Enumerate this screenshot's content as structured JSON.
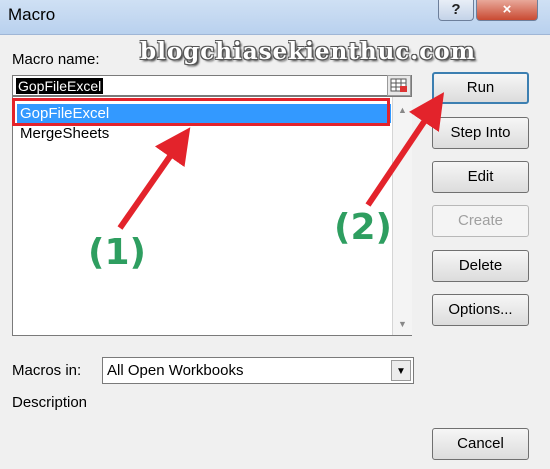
{
  "window": {
    "title": "Macro",
    "help_label": "?",
    "close_label": "×"
  },
  "watermark": "blogchiasekienthuc.com",
  "macro_name": {
    "label": "Macro name:",
    "value": "GopFileExcel"
  },
  "macro_list": {
    "items": [
      "GopFileExcel",
      "MergeSheets"
    ],
    "selected_index": 0,
    "scroll_up": "▲",
    "scroll_down": "▼"
  },
  "buttons": {
    "run": "Run",
    "step_into": "Step Into",
    "edit": "Edit",
    "create": "Create",
    "delete": "Delete",
    "options": "Options...",
    "cancel": "Cancel"
  },
  "macros_in": {
    "label": "Macros in:",
    "value": "All Open Workbooks",
    "arrow": "▼"
  },
  "description": {
    "label": "Description"
  },
  "annotations": {
    "step1": "(1)",
    "step2": "(2)",
    "arrow_color": "#e3232b",
    "step_color": "#2e9e60"
  }
}
